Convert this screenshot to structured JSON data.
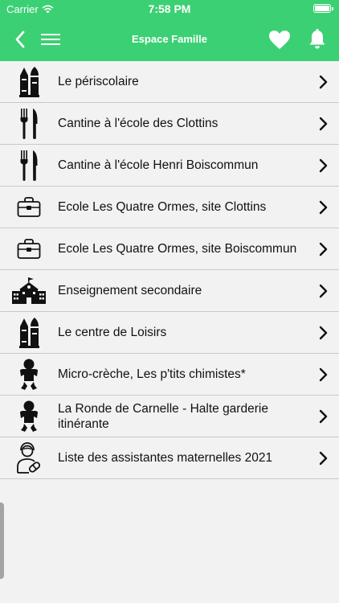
{
  "status_bar": {
    "carrier": "Carrier",
    "time": "7:58 PM"
  },
  "nav": {
    "title": "Espace Famille"
  },
  "rows": [
    {
      "label": "Le périscolaire",
      "icon": "pencils-icon"
    },
    {
      "label": "Cantine à l'école des Clottins",
      "icon": "fork-knife-icon"
    },
    {
      "label": "Cantine à l'école Henri Boiscommun",
      "icon": "fork-knife-icon"
    },
    {
      "label": "Ecole Les Quatre Ormes, site Clottins",
      "icon": "school-bag-icon"
    },
    {
      "label": "Ecole Les Quatre Ormes, site Boiscommun",
      "icon": "school-bag-icon"
    },
    {
      "label": "Enseignement secondaire",
      "icon": "school-building-icon"
    },
    {
      "label": "Le centre de Loisirs",
      "icon": "pencils-icon"
    },
    {
      "label": "Micro-crèche, Les p'tits chimistes*",
      "icon": "baby-icon"
    },
    {
      "label": "La Ronde de Carnelle - Halte garderie itinérante",
      "icon": "baby-icon"
    },
    {
      "label": "Liste des assistantes maternelles 2021",
      "icon": "nanny-icon"
    }
  ],
  "colors": {
    "accent": "#3cd074",
    "background": "#f2f2f2",
    "divider": "#c9c9c9",
    "text": "#111111"
  }
}
